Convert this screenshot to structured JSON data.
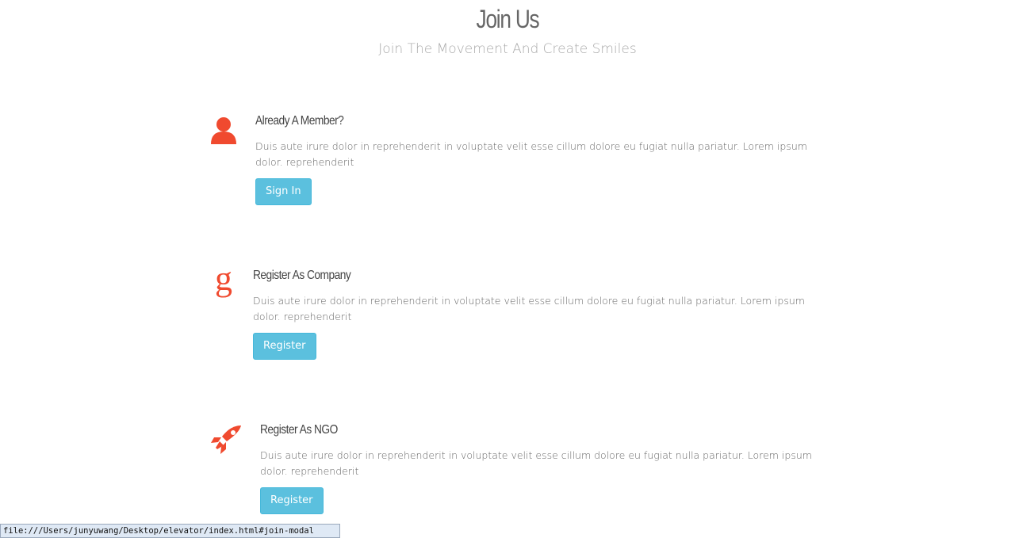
{
  "header": {
    "title": "Join Us",
    "subtitle": "Join The Movement And Create Smiles"
  },
  "sections": [
    {
      "icon": "user-icon",
      "title": "Already A Member?",
      "description": "Duis aute irure dolor in reprehenderit in voluptate velit esse cillum dolore eu fugiat nulla pariatur. Lorem ipsum dolor. reprehenderit",
      "button_label": "Sign In"
    },
    {
      "icon": "google-g-icon",
      "title": "Register As Company",
      "description": "Duis aute irure dolor in reprehenderit in voluptate velit esse cillum dolore eu fugiat nulla pariatur. Lorem ipsum dolor. reprehenderit",
      "button_label": "Register"
    },
    {
      "icon": "rocket-icon",
      "title": "Register As NGO",
      "description": "Duis aute irure dolor in reprehenderit in voluptate velit esse cillum dolore eu fugiat nulla pariatur. Lorem ipsum dolor. reprehenderit",
      "button_label": "Register"
    }
  ],
  "status_bar": {
    "url": "file:///Users/junyuwang/Desktop/elevator/index.html#join-modal"
  },
  "colors": {
    "accent": "#f04a2f",
    "button": "#5bc0de",
    "button_border": "#46b8da"
  }
}
